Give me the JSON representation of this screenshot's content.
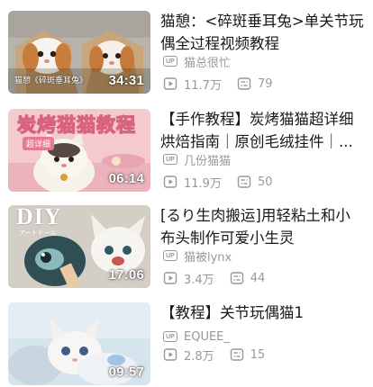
{
  "videos": [
    {
      "duration": "34:31",
      "thumb_text": "猫憩《碎斑垂耳兔》",
      "title": "猫憩：<碎斑垂耳兔>单关节玩偶全过程视频教程",
      "up_badge": "UP",
      "uploader": "猫总很忙",
      "views": "11.7万",
      "comments": "79"
    },
    {
      "duration": "06:14",
      "thumb_text": "炭烤猫猫教程",
      "thumb_subtext": "超详细",
      "title": "【手作教程】炭烤猫猫超详细烘焙指南｜原创毛绒挂件｜...",
      "up_badge": "UP",
      "uploader": "几份猫猫",
      "views": "11.9万",
      "comments": "50"
    },
    {
      "duration": "17:06",
      "thumb_text": "DIY",
      "thumb_subtext": "アートドール",
      "title": "[るり生肉搬运]用轻粘土和小布头制作可爱小生灵",
      "up_badge": "UP",
      "uploader": "猫被lynx",
      "views": "3.4万",
      "comments": "44"
    },
    {
      "duration": "09:57",
      "title": "【教程】关节玩偶猫1",
      "up_badge": "UP",
      "uploader": "EQUEE_",
      "views": "2.8万",
      "comments": "15"
    }
  ]
}
